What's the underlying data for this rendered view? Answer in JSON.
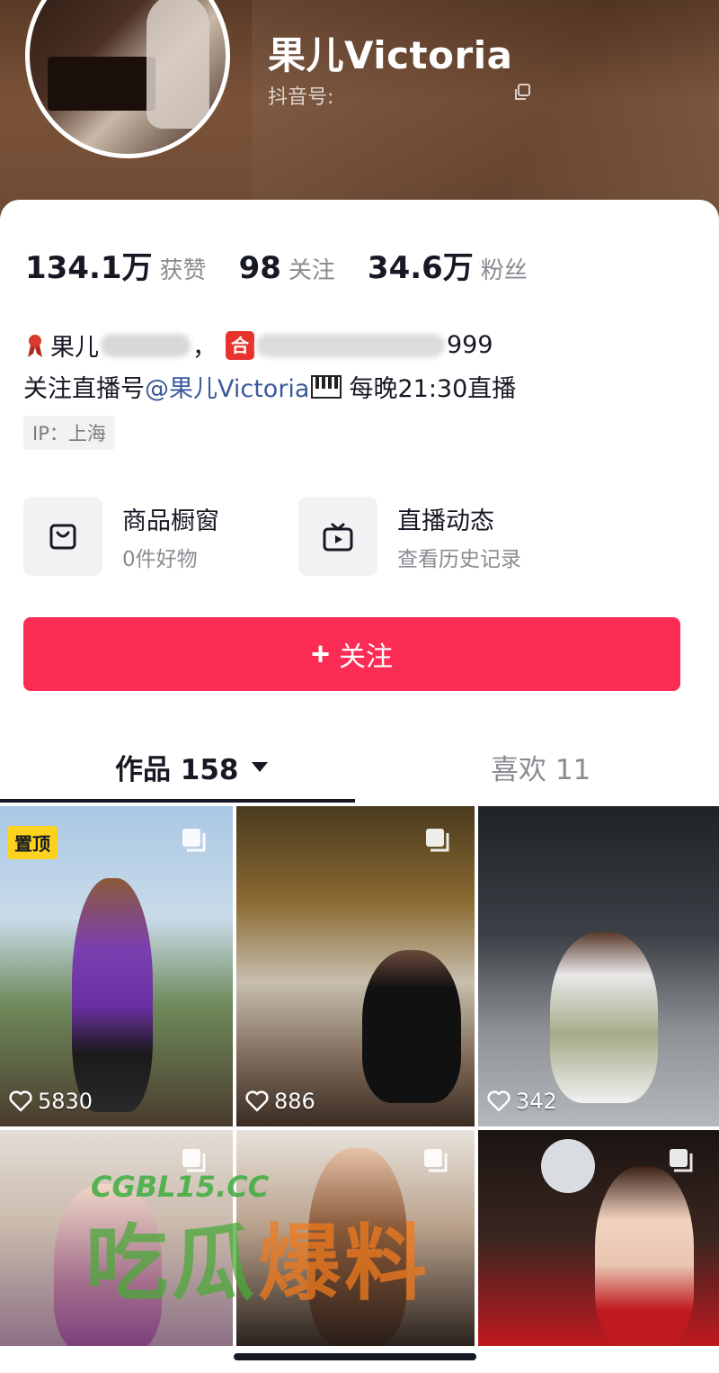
{
  "profile": {
    "nickname": "果儿Victoria",
    "douyin_id_label": "抖音号:",
    "douyin_id_value": "",
    "ip_label": "IP：上海"
  },
  "stats": [
    {
      "value": "134.1万",
      "label": "获赞"
    },
    {
      "value": "98",
      "label": "关注"
    },
    {
      "value": "34.6万",
      "label": "粉丝"
    }
  ],
  "bio": {
    "line1_prefix": "果儿",
    "line1_suffix": "999",
    "line1_badge": "合",
    "line2_before": "关注直播号",
    "line2_mention": "@果儿Victoria",
    "line2_after": "每晚21:30直播"
  },
  "entries": [
    {
      "title": "商品橱窗",
      "subtitle": "0件好物",
      "icon": "shopping-bag-icon"
    },
    {
      "title": "直播动态",
      "subtitle": "查看历史记录",
      "icon": "tv-icon"
    }
  ],
  "follow_button": {
    "plus": "+",
    "label": "关注"
  },
  "tabs": {
    "works": "作品 158",
    "likes": "喜欢 11"
  },
  "videos": [
    {
      "pinned_label": "置顶",
      "likes": "5830"
    },
    {
      "likes": "886"
    },
    {
      "likes": "342"
    },
    {},
    {},
    {}
  ],
  "watermark": {
    "line1": "CGBL15.CC",
    "line2a": "吃瓜",
    "line2b": "爆料"
  },
  "colors": {
    "accent": "#fd2c55",
    "pin_badge": "#fcd21f",
    "mention": "#3b5a9a"
  }
}
